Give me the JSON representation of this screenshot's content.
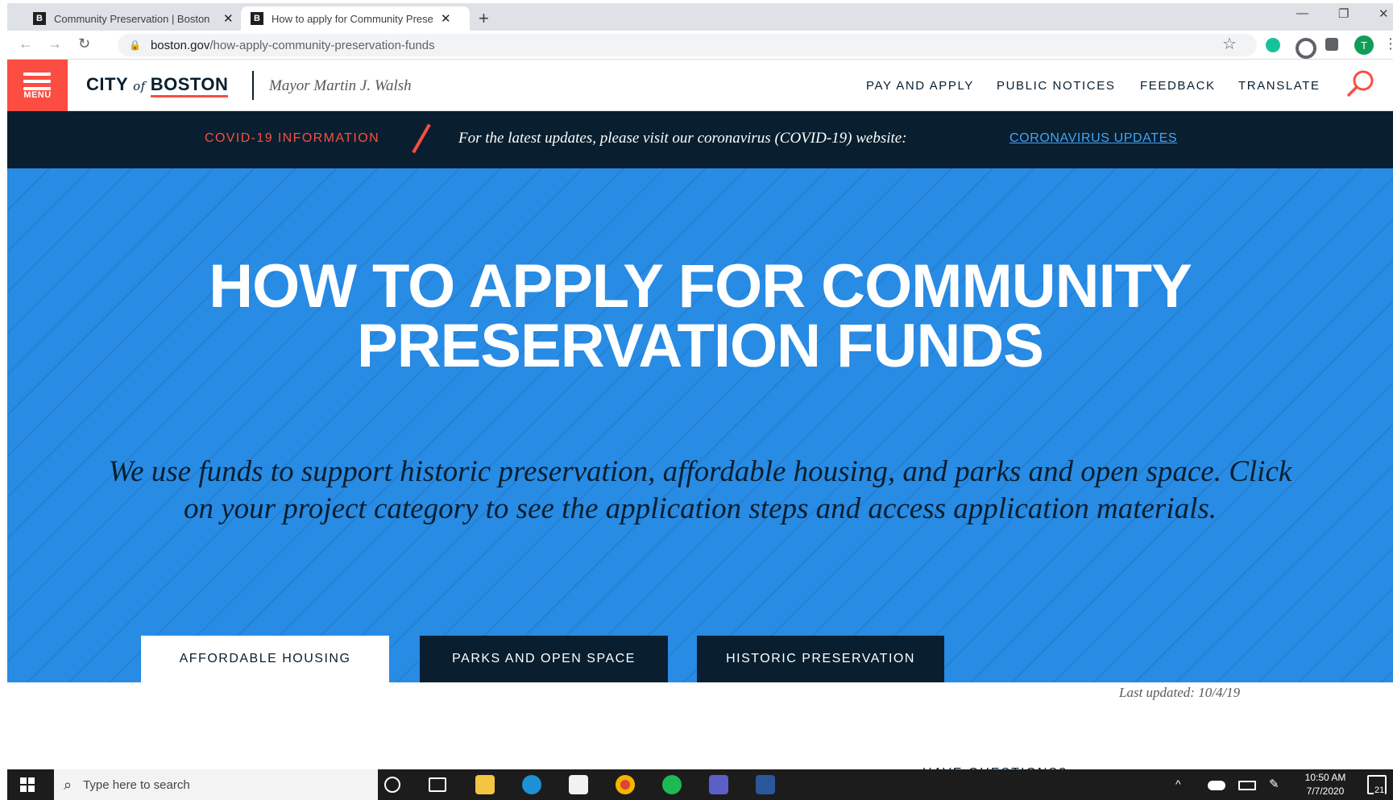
{
  "browser": {
    "tabs": [
      {
        "favicon": "B",
        "title": "Community Preservation | Boston"
      },
      {
        "favicon": "B",
        "title": "How to apply for Community Preservation Funds"
      }
    ],
    "new_tab": "+",
    "close": "✕",
    "window_controls": {
      "minimize": "—",
      "restore": "❐",
      "close": "✕"
    },
    "nav": {
      "back": "←",
      "forward": "→",
      "reload": "↻"
    },
    "url_host": "boston.gov",
    "url_path": "/how-apply-community-preservation-funds",
    "star": "☆",
    "profile_initial": "T",
    "more": "⋮",
    "colors": {
      "grammarly": "#15c39a",
      "profile": "#0f9d58"
    }
  },
  "site_header": {
    "menu_label": "MENU",
    "logo_city": "CITY",
    "logo_of": "of",
    "logo_boston": "BOSTON",
    "mayor": "Mayor Martin J. Walsh",
    "nav": [
      "PAY AND APPLY",
      "PUBLIC NOTICES",
      "FEEDBACK",
      "TRANSLATE"
    ],
    "search_icon": "search-icon",
    "colors": {
      "accent": "#fb4d42",
      "navy": "#091f2f"
    }
  },
  "covid": {
    "label": "COVID-19 INFORMATION",
    "text": "For the latest updates, please visit our coronavirus (COVID-19) website:",
    "link": "CORONAVIRUS UPDATES"
  },
  "hero": {
    "title": "HOW TO APPLY FOR COMMUNITY PRESERVATION FUNDS",
    "lead": "We use funds to support historic preservation, affordable housing, and parks and open space. Click on your project category to see the application steps and access application materials.",
    "tabs": [
      {
        "label": "AFFORDABLE HOUSING",
        "selected": true
      },
      {
        "label": "PARKS AND OPEN SPACE",
        "selected": false
      },
      {
        "label": "HISTORIC PRESERVATION",
        "selected": false
      }
    ],
    "colors": {
      "background": "#288be4"
    }
  },
  "last_updated": "Last updated: 10/4/19",
  "have_questions": "HAVE QUESTIONS?",
  "taskbar": {
    "search_placeholder": "Type here to search",
    "time": "10:50 AM",
    "date": "7/7/2020",
    "notifications": "21"
  }
}
